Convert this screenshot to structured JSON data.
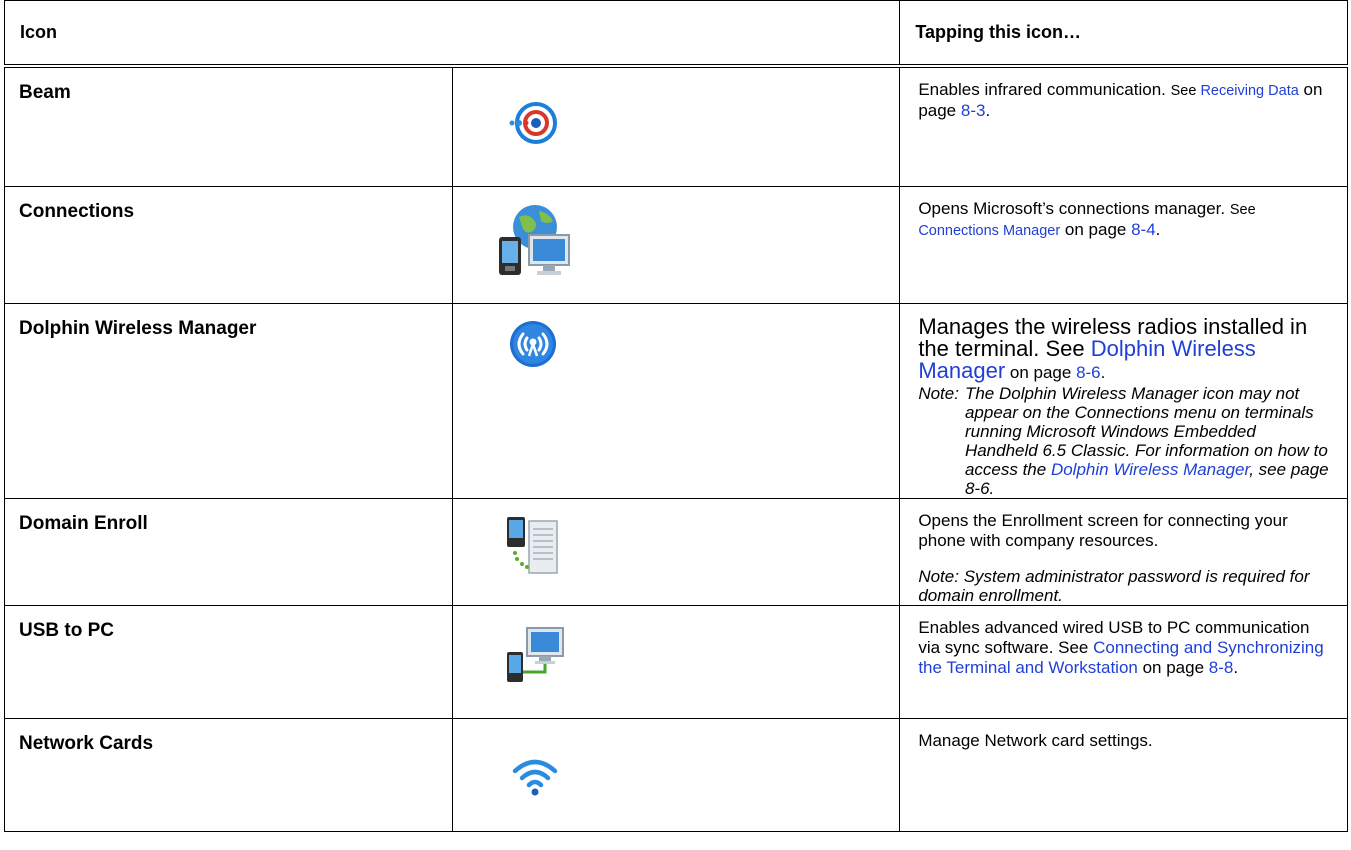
{
  "header": {
    "col_icon": "Icon",
    "col_desc": "Tapping this icon…"
  },
  "rows": [
    {
      "name": "Beam",
      "icon": "beam-icon",
      "desc_text": "Enables infrared communication. ",
      "see": "See ",
      "link": "Receiving Data",
      "on_page": " on page ",
      "page": "8-3",
      "end": "."
    },
    {
      "name": "Connections",
      "icon": "connections-icon",
      "desc_text": "Opens Microsoft’s connections manager. ",
      "see": "See ",
      "link": "Connections Manager",
      "on_page": " on page ",
      "page": "8-4",
      "end": "."
    },
    {
      "name": "Dolphin Wireless Manager",
      "icon": "wireless-manager-icon",
      "desc_text": "Manages the wireless radios installed in the terminal. See ",
      "link": "Dolphin Wireless Manager",
      "on_page": " on page ",
      "page": "8-6",
      "end": ".",
      "note_label": "Note:",
      "note_text": "The Dolphin Wireless Manager icon may not appear on the Connections menu on terminals running Microsoft Windows Embedded Handheld 6.5 Classic. For information on how to access the ",
      "note_link": "Dolphin Wireless Manager",
      "note_end": ", see page 8-6."
    },
    {
      "name": "Domain Enroll",
      "icon": "domain-enroll-icon",
      "desc_text": "Opens the Enrollment screen for connecting your phone with company resources.",
      "note_label": "Note:",
      "note_text": "System administrator password is required for domain enrollment."
    },
    {
      "name": "USB to PC",
      "icon": "usb-to-pc-icon",
      "desc_text": "Enables advanced wired USB to PC communication via sync software. See ",
      "link": "Connecting and Synchronizing the Terminal and Workstation",
      "on_page": " on page ",
      "page": "8-8",
      "end": "."
    },
    {
      "name": "Network Cards",
      "icon": "network-cards-icon",
      "desc_text": "Manage Network card settings."
    }
  ]
}
